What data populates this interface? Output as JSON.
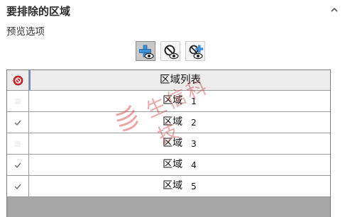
{
  "panel": {
    "title": "要排除的区域",
    "subtitle": "预览选项"
  },
  "toolbar": {
    "buttons": [
      {
        "icon": "add-preview-icon",
        "active": true
      },
      {
        "icon": "hide-preview-icon",
        "active": false
      },
      {
        "icon": "show-preview-icon",
        "active": false
      }
    ]
  },
  "table": {
    "header_icon": "exclude-icon",
    "column_header": "区域列表",
    "rows": [
      {
        "name": "区域",
        "number": "1",
        "checked": false
      },
      {
        "name": "区域",
        "number": "2",
        "checked": true
      },
      {
        "name": "区域",
        "number": "3",
        "checked": false
      },
      {
        "name": "区域",
        "number": "4",
        "checked": true
      },
      {
        "name": "区域",
        "number": "5",
        "checked": true
      }
    ]
  },
  "watermark": {
    "text": "生信科技"
  },
  "colors": {
    "accent_red": "#d62828",
    "check_gray": "#6d6d6d",
    "header_bg": "#ececec",
    "empty_area": "#a6a6a6"
  }
}
